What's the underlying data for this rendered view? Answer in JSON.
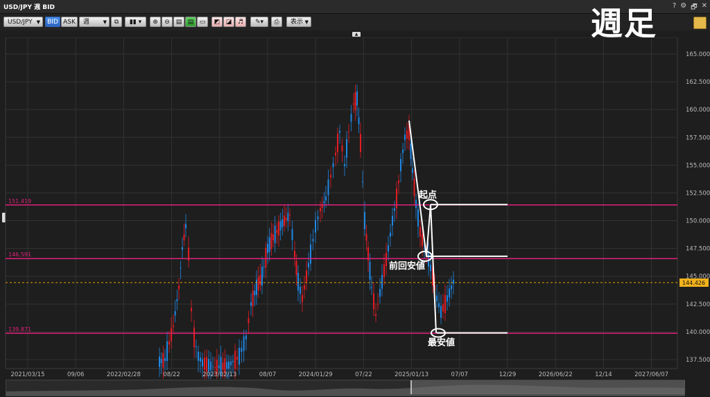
{
  "window": {
    "title": "USD/JPY 週 BID",
    "controls": [
      "?",
      "⚙",
      "🗗",
      "✕"
    ]
  },
  "toolbar": {
    "symbol": "USD/JPY",
    "bid_label": "BID",
    "ask_label": "ASK",
    "period": "週",
    "display_label": "表示"
  },
  "overlay_title": "週足",
  "chart_data": {
    "type": "candlestick",
    "y_ticks": [
      "165.000",
      "162.500",
      "160.000",
      "157.500",
      "155.000",
      "152.500",
      "150.000",
      "147.500",
      "145.000",
      "142.500",
      "140.000",
      "137.500"
    ],
    "x_ticks": [
      "2021/03/15",
      "09/06",
      "2022/02/28",
      "08/22",
      "2023/02/13",
      "08/07",
      "2024/01/29",
      "07/22",
      "2025/01/13",
      "07/07",
      "12/29",
      "2026/06/22",
      "12/14",
      "2027/06/07"
    ],
    "ylim": [
      137.0,
      166.5
    ],
    "current_price": 144.426,
    "lines": [
      {
        "label": "151.419",
        "value": 151.419,
        "color": "#e0207a"
      },
      {
        "label": "146.591",
        "value": 146.591,
        "color": "#e0207a"
      },
      {
        "label": "139.871",
        "value": 139.871,
        "color": "#e0207a"
      }
    ],
    "annotations": [
      {
        "text": "起点",
        "value": 151.45
      },
      {
        "text": "前回安値",
        "value": 146.8
      },
      {
        "text": "最安値",
        "value": 139.9
      }
    ]
  }
}
